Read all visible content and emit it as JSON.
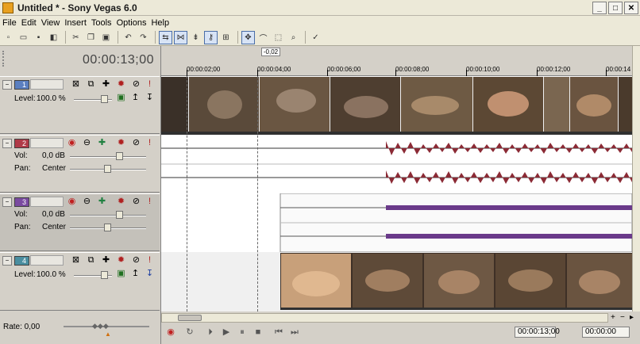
{
  "window": {
    "title": "Untitled * - Sony Vegas 6.0"
  },
  "menu": [
    "File",
    "Edit",
    "View",
    "Insert",
    "Tools",
    "Options",
    "Help"
  ],
  "timecode": "00:00:13;00",
  "marker_label": "-0,02",
  "ruler_ticks": [
    "00:00:02;00",
    "00:00:04;00",
    "00:00:06;00",
    "00:00:08;00",
    "00:00:10;00",
    "00:00:12;00",
    "00:00:14"
  ],
  "tracks": [
    {
      "number": "1",
      "type": "video",
      "level_label": "Level:",
      "level_value": "100.0 %",
      "color": "#5b7fc0"
    },
    {
      "number": "2",
      "type": "audio",
      "vol_label": "Vol:",
      "vol_value": "0,0 dB",
      "pan_label": "Pan:",
      "pan_value": "Center",
      "color": "#b03a48"
    },
    {
      "number": "3",
      "type": "audio",
      "vol_label": "Vol:",
      "vol_value": "0,0 dB",
      "pan_label": "Pan:",
      "pan_value": "Center",
      "color": "#7a4aa0"
    },
    {
      "number": "4",
      "type": "video",
      "level_label": "Level:",
      "level_value": "100.0 %",
      "color": "#4a8ea0"
    }
  ],
  "rate": "Rate: 0,00",
  "transport": {
    "timecode_1": "00:00:13;00",
    "timecode_2": "00:00:00"
  },
  "colors": {
    "audio_track_2": "#8b2a35",
    "audio_track_3": "#6a3a8a"
  }
}
